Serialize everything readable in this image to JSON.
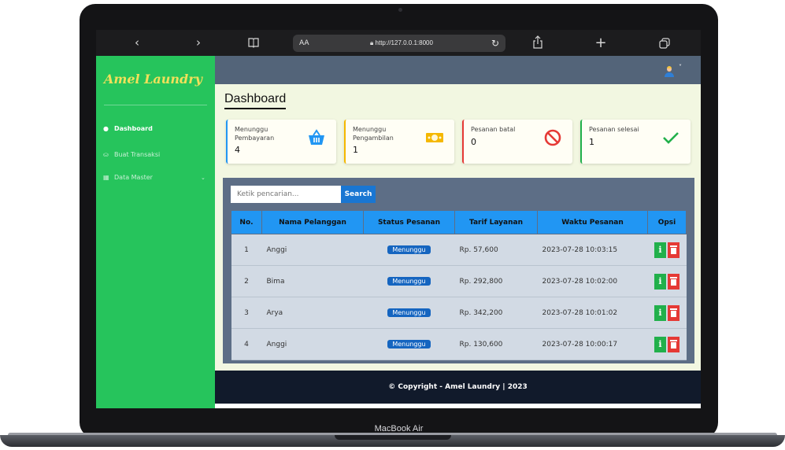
{
  "device": {
    "model_label": "MacBook Air"
  },
  "browser": {
    "back_icon": "chevron-left-icon",
    "forward_icon": "chevron-right-icon",
    "reader_icon": "book-icon",
    "text_size_label": "AA",
    "url": "http://127.0.0.1:8000",
    "reload_icon": "reload-icon",
    "share_icon": "share-icon",
    "new_tab_label": "+",
    "tabs_icon": "tabs-icon"
  },
  "sidebar": {
    "brand": "Amel Laundry",
    "items": [
      {
        "label": "Dashboard",
        "icon": "info-circle-icon",
        "active": true
      },
      {
        "label": "Buat Transaksi",
        "icon": "basket-icon",
        "active": false
      },
      {
        "label": "Data Master",
        "icon": "table-icon",
        "active": false
      }
    ]
  },
  "page": {
    "title": "Dashboard"
  },
  "cards": [
    {
      "label": "Menunggu Pembayaran",
      "value": "4",
      "icon": "basket-icon",
      "accent": "#2196f3"
    },
    {
      "label": "Menunggu Pengambilan",
      "value": "1",
      "icon": "money-icon",
      "accent": "#f5b800"
    },
    {
      "label": "Pesanan batal",
      "value": "0",
      "icon": "ban-icon",
      "accent": "#e53935"
    },
    {
      "label": "Pesanan selesai",
      "value": "1",
      "icon": "check-icon",
      "accent": "#21b04b"
    }
  ],
  "search": {
    "placeholder": "Ketik pencarian...",
    "button_label": "Search"
  },
  "table": {
    "headers": [
      "No.",
      "Nama Pelanggan",
      "Status Pesanan",
      "Tarif Layanan",
      "Waktu Pesanan",
      "Opsi"
    ],
    "rows": [
      {
        "no": "1",
        "name": "Anggi",
        "status": "Menunggu",
        "tarif": "Rp. 57,600",
        "waktu": "2023-07-28 10:03:15",
        "info": "i"
      },
      {
        "no": "2",
        "name": "Bima",
        "status": "Menunggu",
        "tarif": "Rp. 292,800",
        "waktu": "2023-07-28 10:02:00",
        "info": "i"
      },
      {
        "no": "3",
        "name": "Arya",
        "status": "Menunggu",
        "tarif": "Rp. 342,200",
        "waktu": "2023-07-28 10:01:02",
        "info": "i"
      },
      {
        "no": "4",
        "name": "Anggi",
        "status": "Menunggu",
        "tarif": "Rp. 130,600",
        "waktu": "2023-07-28 10:00:17",
        "info": "i"
      }
    ]
  },
  "footer": {
    "text": "© Copyright - Amel Laundry | 2023"
  }
}
